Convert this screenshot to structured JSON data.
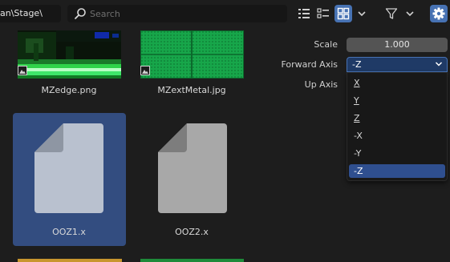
{
  "header": {
    "path": "an\\Stage\\",
    "search_placeholder": "Search"
  },
  "files": [
    {
      "name": "MZedge.png",
      "type": "image"
    },
    {
      "name": "MZextMetal.jpg",
      "type": "image"
    },
    {
      "name": "OOZ1.x",
      "type": "file",
      "selected": true
    },
    {
      "name": "OOZ2.x",
      "type": "file",
      "selected": false
    }
  ],
  "properties": {
    "scale_label": "Scale",
    "scale_value": "1.000",
    "forward_axis_label": "Forward Axis",
    "forward_axis_value": "-Z",
    "up_axis_label": "Up Axis",
    "axis_options": [
      "X",
      "Y",
      "Z",
      "-X",
      "-Y",
      "-Z"
    ],
    "axis_selected": "-Z"
  },
  "colors": {
    "accent": "#4772b3",
    "selection": "#334d80",
    "background": "#1d1d1d"
  },
  "icons": [
    "search-icon",
    "list-view-icon",
    "thumbnail-small-icon",
    "thumbnail-large-icon",
    "chevron-down-icon",
    "filter-icon",
    "gear-icon",
    "image-badge-icon",
    "file-icon"
  ]
}
